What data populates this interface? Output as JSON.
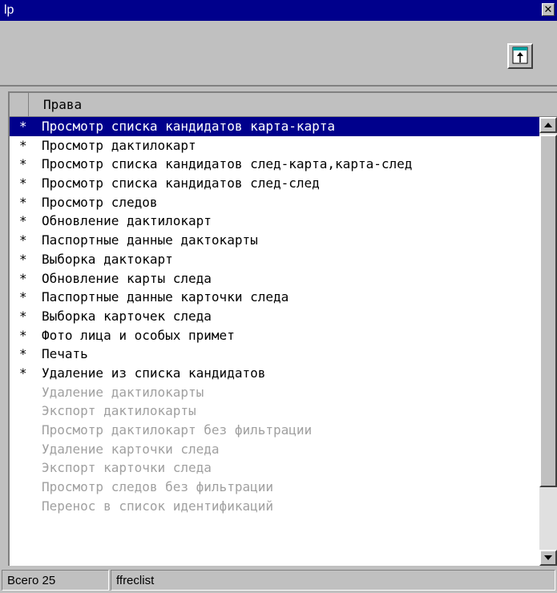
{
  "window": {
    "title": "lp",
    "close_glyph": "✕"
  },
  "toolbar": {
    "button_icon": "window-up-arrow-icon"
  },
  "list": {
    "header": "Права",
    "rows": [
      {
        "mark": "*",
        "label": "Просмотр списка кандидатов карта-карта",
        "selected": true,
        "enabled": true
      },
      {
        "mark": "*",
        "label": "Просмотр дактилокарт",
        "selected": false,
        "enabled": true
      },
      {
        "mark": "*",
        "label": "Просмотр списка кандидатов след-карта,карта-след",
        "selected": false,
        "enabled": true
      },
      {
        "mark": "*",
        "label": "Просмотр списка кандидатов след-след",
        "selected": false,
        "enabled": true
      },
      {
        "mark": "*",
        "label": "Просмотр следов",
        "selected": false,
        "enabled": true
      },
      {
        "mark": "*",
        "label": "Обновление дактилокарт",
        "selected": false,
        "enabled": true
      },
      {
        "mark": "*",
        "label": "Паспортные данные дактокарты",
        "selected": false,
        "enabled": true
      },
      {
        "mark": "*",
        "label": "Выборка дактокарт",
        "selected": false,
        "enabled": true
      },
      {
        "mark": "*",
        "label": "Обновление карты следа",
        "selected": false,
        "enabled": true
      },
      {
        "mark": "*",
        "label": "Паспортные данные карточки следа",
        "selected": false,
        "enabled": true
      },
      {
        "mark": "*",
        "label": "Выборка карточек следа",
        "selected": false,
        "enabled": true
      },
      {
        "mark": "*",
        "label": "Фото лица и особых примет",
        "selected": false,
        "enabled": true
      },
      {
        "mark": "*",
        "label": "Печать",
        "selected": false,
        "enabled": true
      },
      {
        "mark": "*",
        "label": "Удаление из списка кандидатов",
        "selected": false,
        "enabled": true
      },
      {
        "mark": "",
        "label": "Удаление дактилокарты",
        "selected": false,
        "enabled": false
      },
      {
        "mark": "",
        "label": "Экспорт дактилокарты",
        "selected": false,
        "enabled": false
      },
      {
        "mark": "",
        "label": "Просмотр дактилокарт без фильтрации",
        "selected": false,
        "enabled": false
      },
      {
        "mark": "",
        "label": "Удаление карточки следа",
        "selected": false,
        "enabled": false
      },
      {
        "mark": "",
        "label": "Экспорт карточки следа",
        "selected": false,
        "enabled": false
      },
      {
        "mark": "",
        "label": "Просмотр следов без фильтрации",
        "selected": false,
        "enabled": false
      },
      {
        "mark": "",
        "label": "Перенос в список идентификаций",
        "selected": false,
        "enabled": false
      }
    ]
  },
  "scrollbar": {
    "up_glyph": "▲",
    "down_glyph": "▼"
  },
  "status": {
    "count": "Всего 25",
    "name": "ffreclist"
  },
  "colors": {
    "title_bg": "#00008c",
    "selected_bg": "#00008c",
    "disabled_text": "#a0a0a0",
    "face": "#c0c0c0"
  }
}
